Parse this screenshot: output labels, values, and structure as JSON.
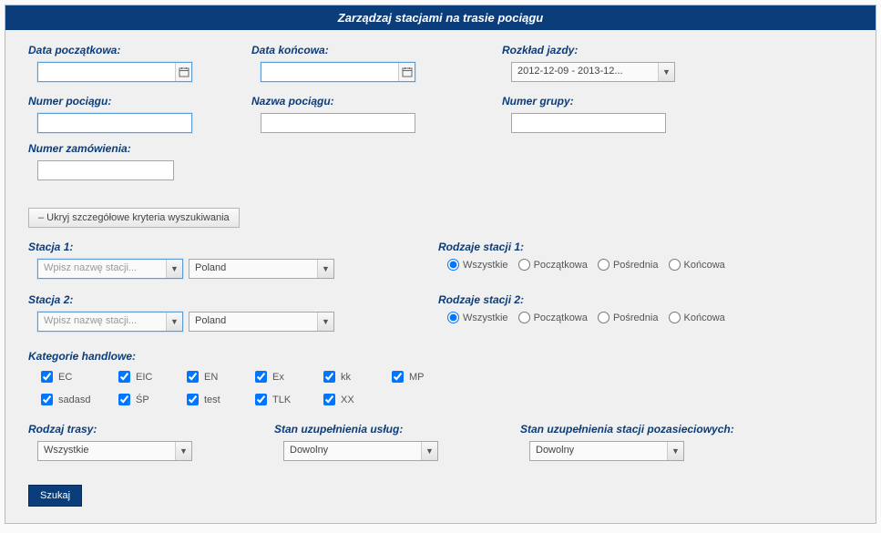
{
  "header": {
    "title": "Zarządzaj stacjami na trasie pociągu"
  },
  "labels": {
    "startDate": "Data początkowa:",
    "endDate": "Data końcowa:",
    "schedule": "Rozkład jazdy:",
    "trainNumber": "Numer pociągu:",
    "trainName": "Nazwa pociągu:",
    "groupNumber": "Numer grupy:",
    "orderNumber": "Numer zamówienia:",
    "station1": "Stacja 1:",
    "station2": "Stacja 2:",
    "stationTypes1": "Rodzaje stacji 1:",
    "stationTypes2": "Rodzaje stacji 2:",
    "tradeCategories": "Kategorie handlowe:",
    "routeType": "Rodzaj trasy:",
    "serviceFillState": "Stan uzupełnienia usług:",
    "offnetFillState": "Stan uzupełnienia stacji pozasieciowych:"
  },
  "values": {
    "schedule": "2012-12-09 - 2013-12...",
    "stationPlaceholder": "Wpisz nazwę stacji...",
    "country": "Poland",
    "routeType": "Wszystkie",
    "any": "Dowolny"
  },
  "toggle": {
    "hideDetails": "–  Ukryj szczegółowe kryteria wyszukiwania"
  },
  "radios": {
    "all": "Wszystkie",
    "start": "Początkowa",
    "mid": "Pośrednia",
    "end": "Końcowa"
  },
  "categories": [
    "EC",
    "EIC",
    "EN",
    "Ex",
    "kk",
    "MP",
    "sadasd",
    "ŚP",
    "test",
    "TLK",
    "XX"
  ],
  "buttons": {
    "search": "Szukaj"
  }
}
